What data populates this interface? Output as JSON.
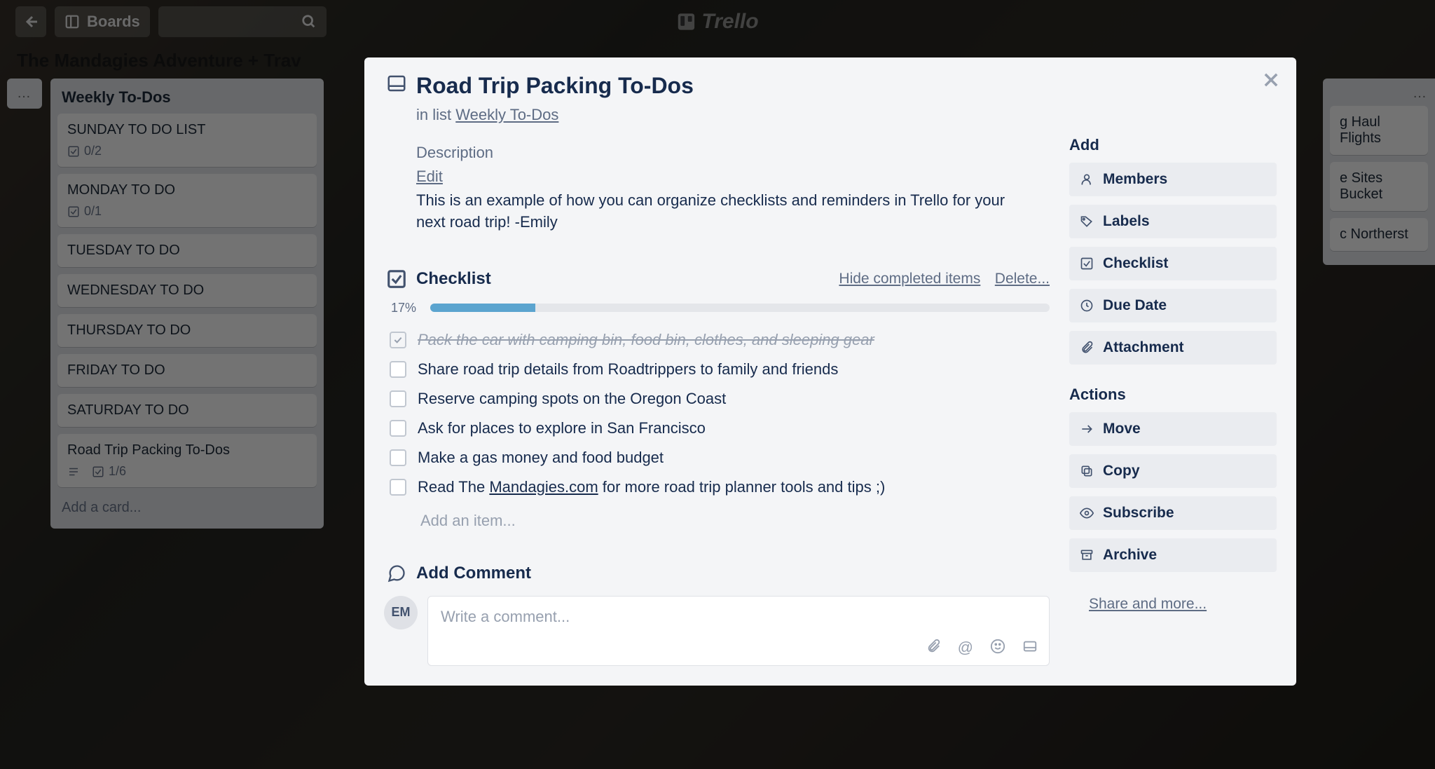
{
  "topbar": {
    "boards_label": "Boards",
    "logo_text": "Trello"
  },
  "board": {
    "title": "The Mandagies Adventure + Trav"
  },
  "left_list": {
    "title": "Weekly To-Dos",
    "cards": [
      {
        "title": "SUNDAY TO DO LIST",
        "badge": "0/2"
      },
      {
        "title": "MONDAY TO DO",
        "badge": "0/1"
      },
      {
        "title": "TUESDAY TO DO",
        "badge": ""
      },
      {
        "title": "WEDNESDAY TO DO",
        "badge": ""
      },
      {
        "title": "THURSDAY TO DO",
        "badge": ""
      },
      {
        "title": "FRIDAY TO DO",
        "badge": ""
      },
      {
        "title": "SATURDAY TO DO",
        "badge": ""
      },
      {
        "title": "Road Trip Packing To-Dos",
        "badge": "1/6",
        "has_desc": true
      }
    ],
    "add_card": "Add a card..."
  },
  "right_list": {
    "cards": [
      "g Haul Flights",
      "e Sites Bucket",
      "c Northerst"
    ]
  },
  "modal": {
    "title": "Road Trip Packing To-Dos",
    "in_list_prefix": "in list ",
    "in_list_link": "Weekly To-Dos",
    "description_label": "Description",
    "edit_label": "Edit",
    "description_text": "This is an example of how you can organize checklists and reminders in Trello for your next road trip! -Emily",
    "checklist": {
      "title": "Checklist",
      "hide_label": "Hide completed items",
      "delete_label": "Delete...",
      "percent": "17%",
      "percent_value": 17,
      "items": [
        {
          "done": true,
          "text": "Pack the car with camping bin, food bin, clothes, and sleeping gear"
        },
        {
          "done": false,
          "text": "Share road trip details from Roadtrippers to family and friends"
        },
        {
          "done": false,
          "text": "Reserve camping spots on the Oregon Coast"
        },
        {
          "done": false,
          "text": "Ask for places to explore in San Francisco"
        },
        {
          "done": false,
          "text": "Make a gas money and food budget"
        },
        {
          "done": false,
          "text_pre": "Read The ",
          "link": "Mandagies.com",
          "text_post": " for more road trip planner tools and tips ;)"
        }
      ],
      "add_item": "Add an item..."
    },
    "comment": {
      "title": "Add Comment",
      "avatar": "EM",
      "placeholder": "Write a comment..."
    },
    "sidebar": {
      "add_heading": "Add",
      "add_buttons": {
        "members": "Members",
        "labels": "Labels",
        "checklist": "Checklist",
        "due_date": "Due Date",
        "attachment": "Attachment"
      },
      "actions_heading": "Actions",
      "action_buttons": {
        "move": "Move",
        "copy": "Copy",
        "subscribe": "Subscribe",
        "archive": "Archive"
      },
      "share_label": "Share and more..."
    }
  }
}
